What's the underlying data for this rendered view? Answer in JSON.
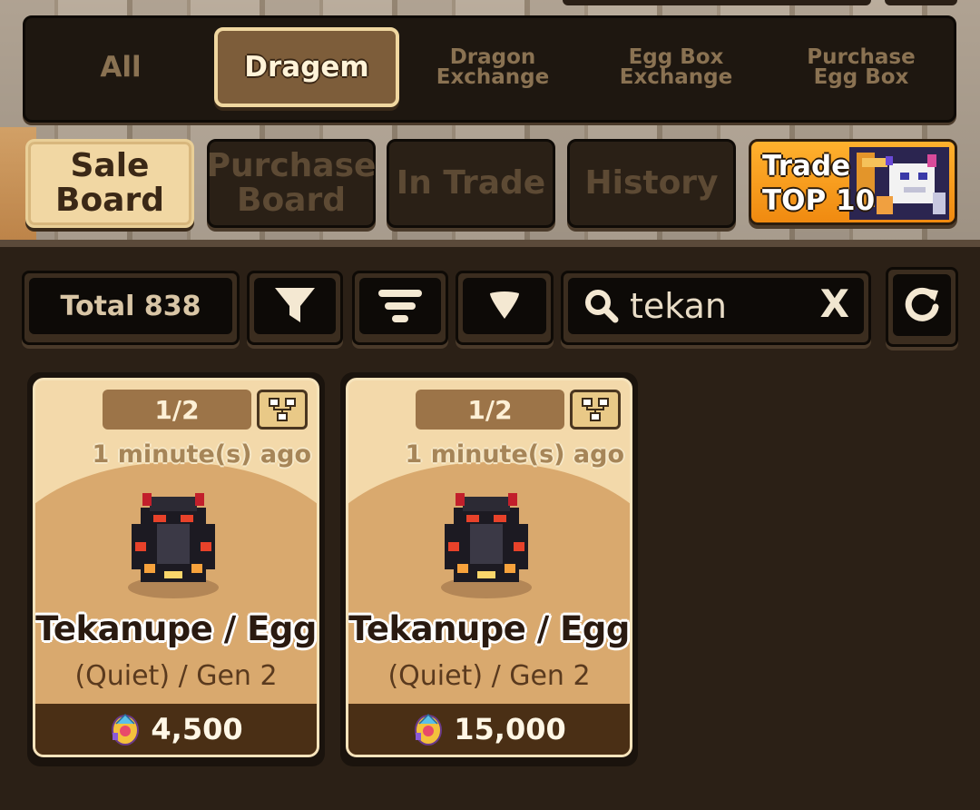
{
  "category_tabs": [
    {
      "label": "All",
      "active": false
    },
    {
      "label": "Dragem",
      "active": true
    },
    {
      "label": "Dragon\nExchange",
      "active": false
    },
    {
      "label": "Egg Box\nExchange",
      "active": false
    },
    {
      "label": "Purchase\nEgg Box",
      "active": false
    }
  ],
  "board_tabs": [
    {
      "label": "Sale\nBoard",
      "active": true
    },
    {
      "label": "Purchase\nBoard",
      "active": false
    },
    {
      "label": "In Trade",
      "active": false
    },
    {
      "label": "History",
      "active": false
    }
  ],
  "top10": {
    "label": "Trade\nTOP 10"
  },
  "toolbar": {
    "total": "Total 838",
    "search_value": "tekan",
    "clear_label": "X"
  },
  "listings": [
    {
      "count": "1/2",
      "time": "1 minute(s) ago",
      "name": "Tekanupe / Egg",
      "sub": "(Quiet) / Gen 2",
      "price": "4,500"
    },
    {
      "count": "1/2",
      "time": "1 minute(s) ago",
      "name": "Tekanupe / Egg",
      "sub": "(Quiet) / Gen 2",
      "price": "15,000"
    }
  ],
  "colors": {
    "accent_orange": "#f08a10",
    "active_tab": "#7d5d3a",
    "card_bg": "#f3d9aa"
  }
}
